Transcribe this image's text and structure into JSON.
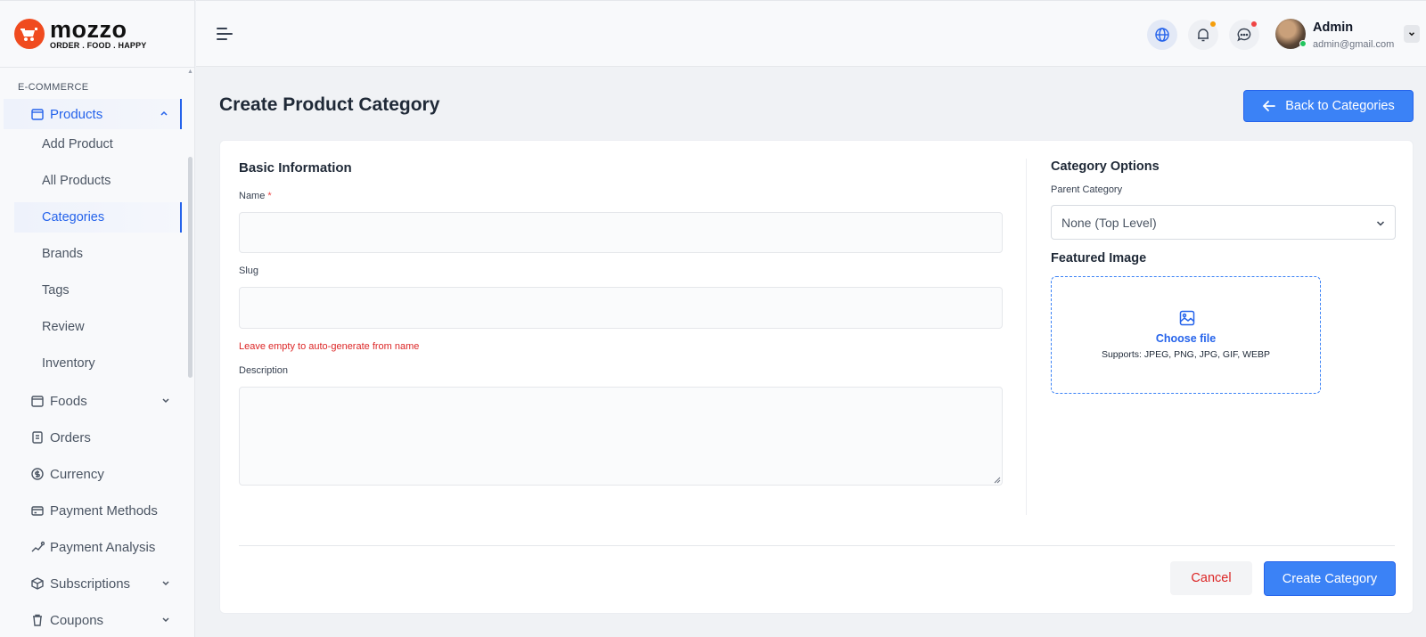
{
  "brand": {
    "name": "mozzo",
    "tagline": "ORDER . FOOD . HAPPY",
    "color": "#f04b1f"
  },
  "sidebar": {
    "section": "E-COMMERCE",
    "products": {
      "label": "Products",
      "icon": "bag-icon"
    },
    "sub_items": [
      "Add Product",
      "All Products",
      "Categories",
      "Brands",
      "Tags",
      "Review",
      "Inventory"
    ],
    "active_sub": "Categories",
    "items": [
      {
        "label": "Foods",
        "icon": "bag-icon",
        "has_children": true
      },
      {
        "label": "Orders",
        "icon": "clipboard-icon",
        "has_children": false
      },
      {
        "label": "Currency",
        "icon": "currency-icon",
        "has_children": false
      },
      {
        "label": "Payment Methods",
        "icon": "credit-card-icon",
        "has_children": false
      },
      {
        "label": "Payment Analysis",
        "icon": "analytics-icon",
        "has_children": false
      },
      {
        "label": "Subscriptions",
        "icon": "box-icon",
        "has_children": true
      },
      {
        "label": "Coupons",
        "icon": "trash-icon",
        "has_children": true
      }
    ]
  },
  "header": {
    "user": {
      "name": "Admin",
      "email": "admin@gmail.com"
    },
    "bell_dot_color": "#f59e0b",
    "chat_dot_color": "#ef4444"
  },
  "page": {
    "title": "Create Product Category",
    "back_label": "Back to Categories"
  },
  "form": {
    "basic_title": "Basic Information",
    "name_label": "Name",
    "name_required": "*",
    "slug_label": "Slug",
    "slug_help": "Leave empty to auto-generate from name",
    "description_label": "Description",
    "options_title": "Category Options",
    "parent_label": "Parent Category",
    "parent_value": "None (Top Level)",
    "featured_title": "Featured Image",
    "choose_file": "Choose file",
    "supports": "Supports: JPEG, PNG, JPG, GIF, WEBP",
    "cancel_label": "Cancel",
    "create_label": "Create Category"
  },
  "colors": {
    "accent": "#3b82f6",
    "danger": "#dc2626"
  }
}
